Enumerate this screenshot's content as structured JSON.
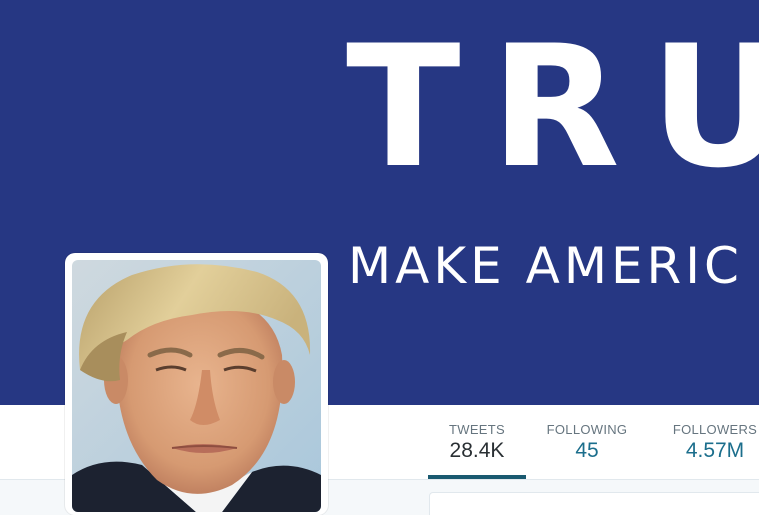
{
  "banner": {
    "headline": "TRU",
    "slogan": "MAKE AMERIC",
    "background_color": "#263783"
  },
  "profile_nav": {
    "active_color": "#1a5a70",
    "value_color": "#1b6e8c",
    "stats": [
      {
        "label": "TWEETS",
        "value": "28.4K",
        "active": true
      },
      {
        "label": "FOLLOWING",
        "value": "45",
        "active": false
      },
      {
        "label": "FOLLOWERS",
        "value": "4.57M",
        "active": false
      }
    ]
  },
  "avatar": {
    "icon": "profile-photo"
  }
}
